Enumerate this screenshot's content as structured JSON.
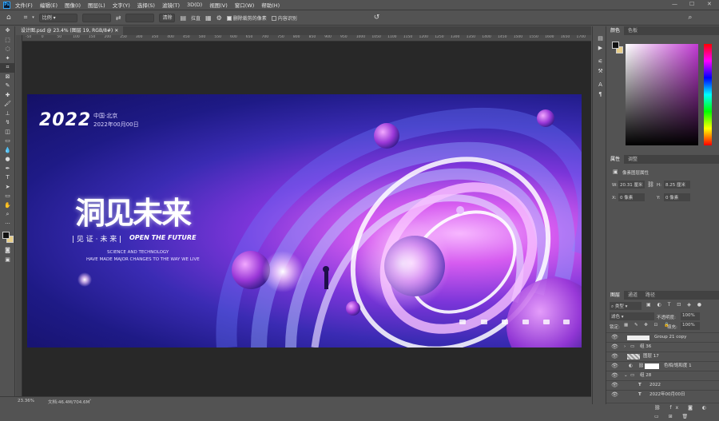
{
  "menu": [
    "文件(F)",
    "编辑(E)",
    "图像(I)",
    "图层(L)",
    "文字(Y)",
    "选择(S)",
    "滤镜(T)",
    "3D(D)",
    "视图(V)",
    "窗口(W)",
    "帮助(H)"
  ],
  "options": {
    "ratio": "比例",
    "clear": "清除",
    "straighten": "拉直",
    "delete_cropped": "删除裁剪的像素",
    "content_aware": "内容识别"
  },
  "document_tab": "设计图.psd @ 23.4% (图层 19, RGB/8#)",
  "ruler_ticks": [
    "-50",
    "0",
    "50",
    "100",
    "150",
    "200",
    "250",
    "300",
    "350",
    "400",
    "450",
    "500",
    "550",
    "600",
    "650",
    "700",
    "750",
    "800",
    "850",
    "900",
    "950",
    "1000",
    "1050",
    "1100",
    "1150",
    "1200",
    "1250",
    "1300",
    "1350",
    "1400",
    "1450",
    "1500",
    "1550",
    "1600",
    "1650",
    "1700"
  ],
  "artwork": {
    "year": "2022",
    "city": "中国·北京",
    "date": "2022年00月00日",
    "headline": "洞见未来",
    "tagline_cn": "| 见 证 · 未 来 |",
    "tagline_en": "OPEN THE FUTURE",
    "sub1": "SCIENCE AND TECHNOLOGY",
    "sub2": "HAVE MADE MAJOR CHANGES TO THE WAY WE LIVE"
  },
  "status": {
    "zoom": "23.36%",
    "doc": "文档:46.4M/704.6M"
  },
  "color_panel": {
    "tabs": [
      "颜色",
      "色板"
    ],
    "fg_color": "#111111",
    "bg_color": "#e8cf8a",
    "hue_color": "#c23bd4"
  },
  "properties": {
    "tabs": [
      "属性",
      "调整"
    ],
    "title": "像素图层属性",
    "w_label": "W:",
    "w_value": "20.31 厘米",
    "h_label": "H:",
    "h_value": "8.25 厘米",
    "x_label": "X:",
    "x_value": "0 像素",
    "y_label": "Y:",
    "y_value": "0 像素"
  },
  "layers": {
    "tabs": [
      "图层",
      "通道",
      "路径"
    ],
    "filter_kind": "类型",
    "blend": "滤色",
    "opacity_label": "不透明度:",
    "opacity": "100%",
    "lock_label": "锁定:",
    "fill_label": "填充:",
    "fill": "100%",
    "rows": [
      "Group 21 copy",
      "组 36",
      "图层 17",
      "色相/饱和度 1",
      "组 28",
      "2022",
      "2022年00月00日"
    ]
  }
}
